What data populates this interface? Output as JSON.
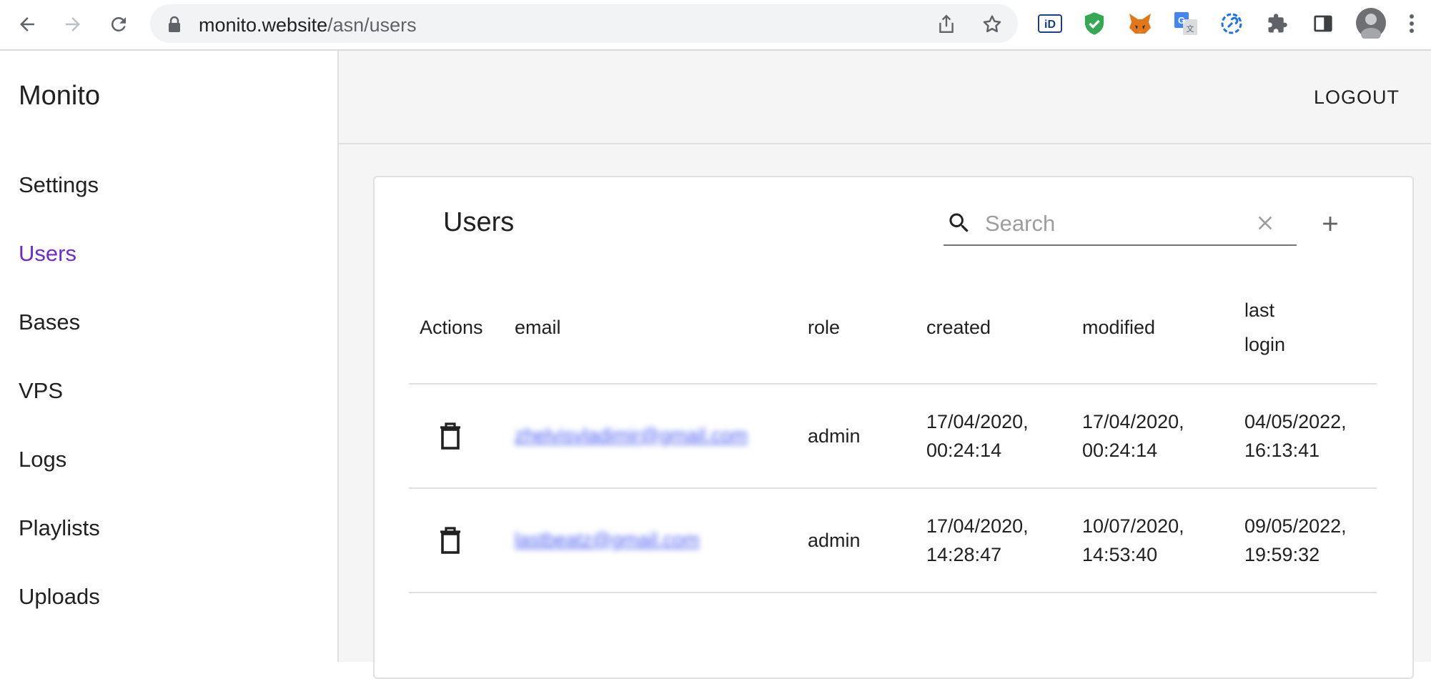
{
  "browser": {
    "url_host": "monito.website",
    "url_path": "/asn/users"
  },
  "app": {
    "title": "Monito"
  },
  "sidebar": {
    "items": [
      {
        "label": "Settings",
        "active": false
      },
      {
        "label": "Users",
        "active": true
      },
      {
        "label": "Bases",
        "active": false
      },
      {
        "label": "VPS",
        "active": false
      },
      {
        "label": "Logs",
        "active": false
      },
      {
        "label": "Playlists",
        "active": false
      },
      {
        "label": "Uploads",
        "active": false
      }
    ]
  },
  "header": {
    "logout_label": "LOGOUT"
  },
  "users_card": {
    "title": "Users",
    "search_placeholder": "Search",
    "search_value": ""
  },
  "table": {
    "columns": {
      "actions": "Actions",
      "email": "email",
      "role": "role",
      "created": "created",
      "modified": "modified",
      "last_login_1": "last",
      "last_login_2": "login"
    },
    "rows": [
      {
        "email": "zhelvisvladimir@gmail.com",
        "role": "admin",
        "created_date": "17/04/2020,",
        "created_time": "00:24:14",
        "modified_date": "17/04/2020,",
        "modified_time": "00:24:14",
        "login_date": "04/05/2022,",
        "login_time": "16:13:41"
      },
      {
        "email": "lastbeatz@gmail.com",
        "role": "admin",
        "created_date": "17/04/2020,",
        "created_time": "14:28:47",
        "modified_date": "10/07/2020,",
        "modified_time": "14:53:40",
        "login_date": "09/05/2022,",
        "login_time": "19:59:32"
      }
    ]
  },
  "colors": {
    "accent": "#6c2bd9",
    "link": "#4a5df0"
  }
}
